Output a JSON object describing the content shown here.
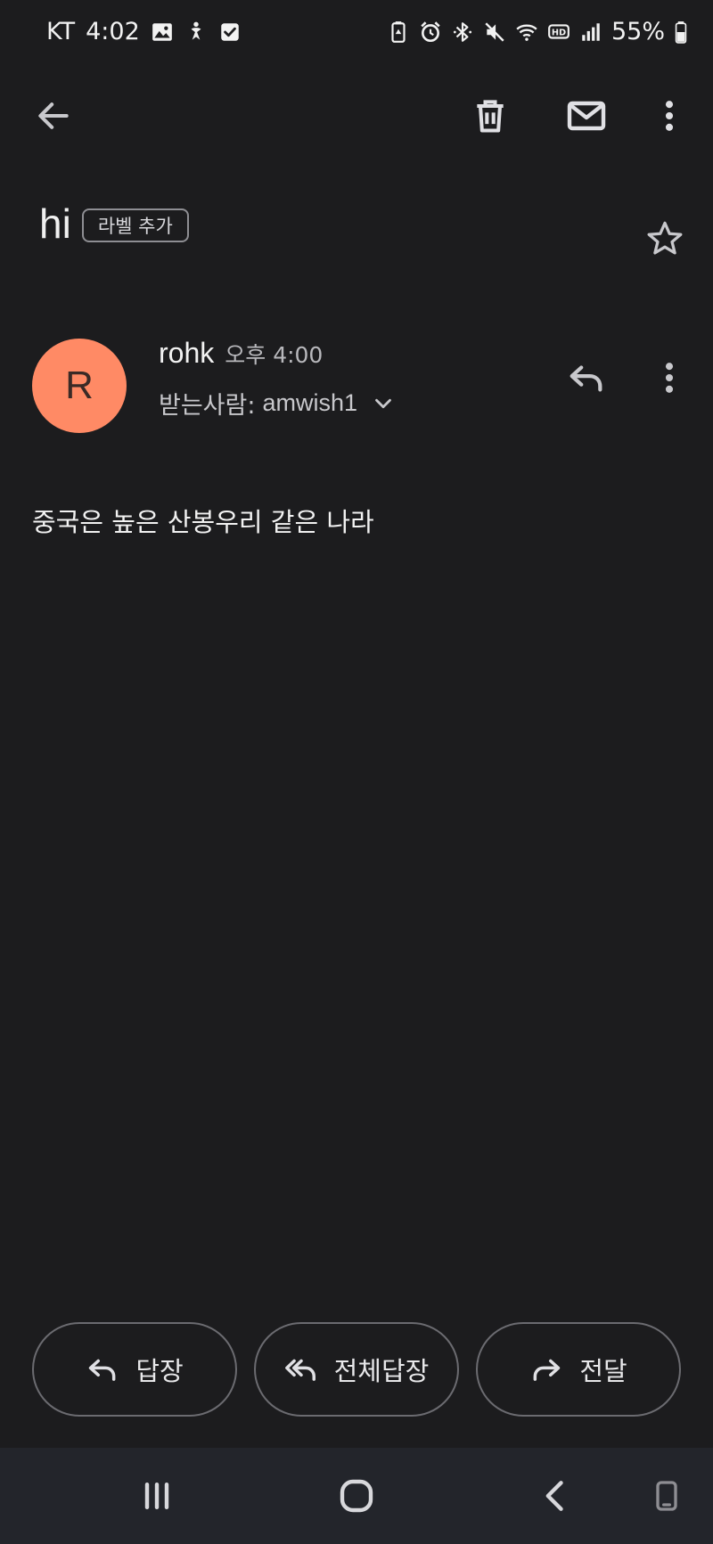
{
  "status_bar": {
    "carrier": "KT",
    "time": "4:02",
    "battery_percent": "55%",
    "left_icons": [
      "gallery-icon",
      "accessibility-icon",
      "checkbox-icon"
    ],
    "right_icons": [
      "battery-saver-icon",
      "alarm-icon",
      "bluetooth-icon",
      "mute-icon",
      "wifi-icon",
      "hd-voice-icon",
      "signal-icon",
      "battery-icon"
    ]
  },
  "app_bar": {
    "icons": [
      "back-arrow-icon",
      "trash-icon",
      "mail-icon",
      "more-vert-icon"
    ]
  },
  "email": {
    "subject": "hi",
    "label_chip": "라벨 추가",
    "sender": {
      "avatar_letter": "R",
      "avatar_color": "#ff8a65",
      "name": "rohk",
      "time": "오후 4:00",
      "recipient_prefix": "받는사람:",
      "recipient": "amwish1"
    },
    "body": "중국은 높은 산봉우리 같은 나라"
  },
  "actions": {
    "reply": "답장",
    "reply_all": "전체답장",
    "forward": "전달"
  },
  "nav_bar": {
    "icons": [
      "recent-apps-icon",
      "home-icon",
      "back-icon",
      "tray-icon"
    ]
  }
}
